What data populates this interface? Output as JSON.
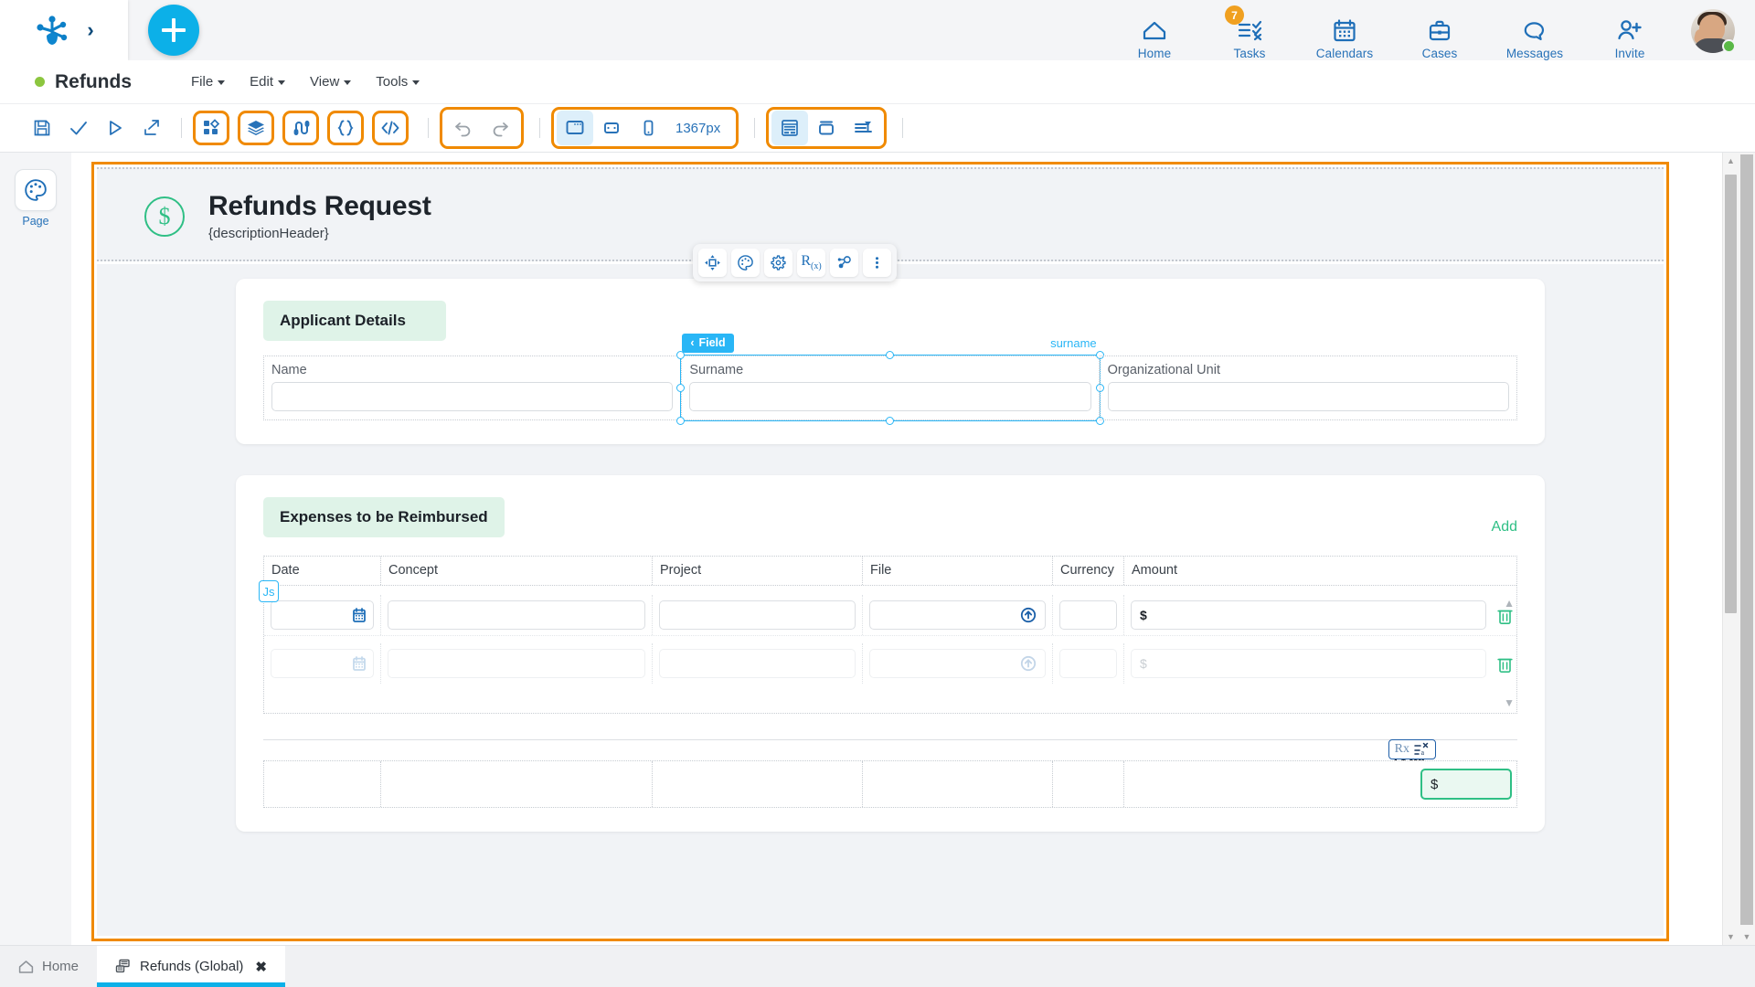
{
  "topbar": {
    "logo_icon": "bonita-logo-icon",
    "expand_icon": "chevron-right-icon",
    "add_button_icon": "plus-icon",
    "nav": [
      {
        "label": "Home",
        "icon": "home-icon",
        "badge": ""
      },
      {
        "label": "Tasks",
        "icon": "tasks-icon",
        "badge": "7"
      },
      {
        "label": "Calendars",
        "icon": "calendar-icon",
        "badge": ""
      },
      {
        "label": "Cases",
        "icon": "briefcase-icon",
        "badge": ""
      },
      {
        "label": "Messages",
        "icon": "message-icon",
        "badge": ""
      },
      {
        "label": "Invite",
        "icon": "invite-user-icon",
        "badge": ""
      }
    ],
    "avatar": {
      "name": "avatar",
      "status": "online"
    }
  },
  "menubar": {
    "doc_title": "Refunds",
    "status_dot_color": "#8cc63f",
    "menus": [
      "File",
      "Edit",
      "View",
      "Tools"
    ]
  },
  "toolbar": {
    "left_icons": [
      "save-icon",
      "validate-check-icon",
      "run-play-icon",
      "export-icon"
    ],
    "group_widgets": [
      "widgets-grid-icon",
      "layers-icon",
      "variables-icon",
      "braces-icon",
      "code-icon"
    ],
    "history": [
      "undo-icon",
      "redo-icon"
    ],
    "viewport": {
      "devices": [
        "desktop-icon",
        "tablet-icon",
        "phone-icon"
      ],
      "active_device": "desktop-icon",
      "width_label": "1367px"
    },
    "panels": [
      "form-preview-icon",
      "container-icon",
      "align-icon"
    ],
    "active_panel": "form-preview-icon",
    "highlight_color": "#f08a00"
  },
  "leftrail": {
    "items": [
      {
        "label": "Page",
        "icon": "palette-icon"
      }
    ]
  },
  "form": {
    "header": {
      "icon": "dollar-circle-icon",
      "title": "Refunds Request",
      "subtitle": "{descriptionHeader}"
    },
    "applicant_section": {
      "title": "Applicant Details",
      "fields": [
        {
          "label": "Name",
          "value": "",
          "selected": false
        },
        {
          "label": "Surname",
          "value": "",
          "selected": true,
          "tag": "Field",
          "binding": "surname"
        },
        {
          "label": "Organizational Unit",
          "value": "",
          "selected": false
        }
      ]
    },
    "float_toolbar": {
      "buttons": [
        "move-icon",
        "style-palette-icon",
        "settings-gear-icon",
        "expression-rx-icon",
        "connector-icon",
        "more-vertical-icon"
      ]
    },
    "expenses_section": {
      "title": "Expenses to be Reimbursed",
      "add_label": "Add",
      "columns": [
        "Date",
        "Concept",
        "Project",
        "File",
        "Currency",
        "Amount"
      ],
      "js_badge": "Js",
      "rows": [
        {
          "ghost": false,
          "date": "",
          "concept": "",
          "project": "",
          "file": "",
          "currency": "",
          "amount_prefix": "$",
          "amount": "",
          "date_icon": "calendar-icon",
          "file_icon": "upload-circle-icon",
          "delete_icon": "trash-icon"
        },
        {
          "ghost": true,
          "date": "",
          "concept": "",
          "project": "",
          "file": "",
          "currency": "",
          "amount_prefix": "$",
          "amount": "",
          "date_icon": "calendar-icon",
          "file_icon": "upload-circle-icon",
          "delete_icon": "trash-icon"
        }
      ],
      "total": {
        "label": "Total",
        "prefix": "$",
        "value": "",
        "badge": "Rx",
        "badge_icon": "expression-editor-icon"
      }
    }
  },
  "tabbar": {
    "tabs": [
      {
        "label": "Home",
        "icon": "home-outline-icon",
        "active": false,
        "closable": false
      },
      {
        "label": "Refunds (Global)",
        "icon": "diagram-icon",
        "active": true,
        "closable": true,
        "close_icon": "close-icon"
      }
    ]
  }
}
